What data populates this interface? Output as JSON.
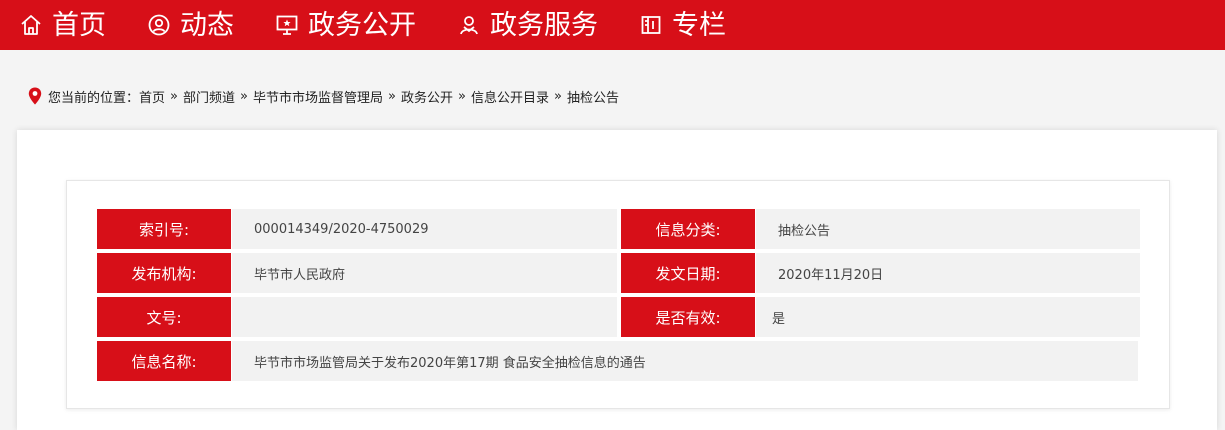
{
  "nav": {
    "items": [
      {
        "label": "首页",
        "icon": "home-icon"
      },
      {
        "label": "动态",
        "icon": "user-circle-icon"
      },
      {
        "label": "政务公开",
        "icon": "monitor-star-icon"
      },
      {
        "label": "政务服务",
        "icon": "users-icon"
      },
      {
        "label": "专栏",
        "icon": "book-icon"
      }
    ]
  },
  "breadcrumb": {
    "prefix": "您当前的位置：",
    "separator": "»",
    "items": [
      "首页",
      "部门频道",
      "毕节市市场监督管理局",
      "政务公开",
      "信息公开目录",
      "抽检公告"
    ]
  },
  "info": {
    "index_label": "索引号:",
    "index_value": "000014349/2020-4750029",
    "category_label": "信息分类:",
    "category_value": "抽检公告",
    "publisher_label": "发布机构:",
    "publisher_value": "毕节市人民政府",
    "date_label": "发文日期:",
    "date_value": "2020年11月20日",
    "docno_label": "文号:",
    "docno_value": "",
    "valid_label": "是否有效:",
    "valid_value": "是",
    "name_label": "信息名称:",
    "name_value": "毕节市市场监管局关于发布2020年第17期 食品安全抽检信息的通告"
  },
  "colors": {
    "brand_red": "#d70f18",
    "value_bg": "#f2f2f2",
    "page_bg": "#f4f4f4"
  }
}
